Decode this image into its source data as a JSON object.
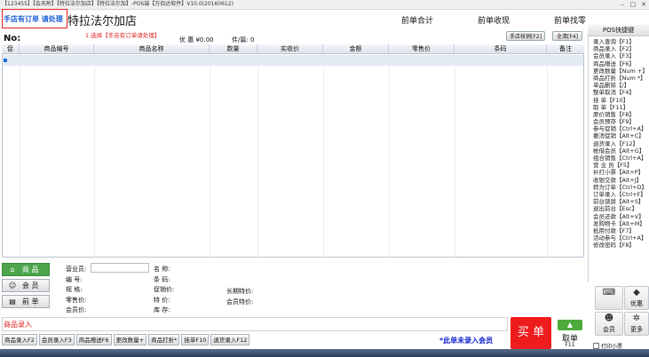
{
  "titlebar": {
    "text": "【123455】【会天附】【特拉法尔加店】【特拉法尔加】-POS端【万佰达软件】V10.0(20160612)"
  },
  "header": {
    "order_link": "手店有订单 请处理",
    "store_name": "特拉法尔加店",
    "note": "1.选择【手店有订单请处理】",
    "prev_total": "前单合计",
    "prev_received": "前单收现",
    "prev_change": "前单找零",
    "no_label": "No:",
    "discount": "优 惠 ¥0.00",
    "count": "件/篇: 0",
    "btn_handheld": "手店核销[F2]",
    "btn_fullscreen": "全清[F4]"
  },
  "table": {
    "columns": [
      "促",
      "商品编号",
      "商品名称",
      "数量",
      "实收价",
      "金额",
      "零售价",
      "条码",
      "备注"
    ]
  },
  "pos_panel": {
    "title": "POS快捷键",
    "items": [
      "录入查询【F1】",
      "商品录入【F2】",
      "会员录入【F3】",
      "商品赠送【F6】",
      "更改数量【Num +】",
      "商品打折【Num *】",
      "单品删除【/】",
      "整单取消【F4】",
      "挂 单【F10】",
      "取 单【F11】",
      "原价销售【F8】",
      "会员预存【F9】",
      "参与促销【Ctrl+A】",
      "撤消促销【Alt+C】",
      "退货录入【F12】",
      "帐借会员【Alt+G】",
      "组合销售【Ctrl+A】",
      "营 业 员【F5】",
      "补打小票【Alt+P】",
      "收银交款【Alt+J】",
      "转为订单【Ctrl+D】",
      "订单录入【Ctrl+F】",
      "前台锁屏【Alt+S】",
      "退出前台【Esc】",
      "会员还款【Alt+V】",
      "发购物卡【Alt+M】",
      "抵用付款【F7】",
      "活动参与【Ctrl+A】",
      "修改密码【F8】"
    ]
  },
  "left_tabs": [
    {
      "label": "商 品",
      "icon": "home-icon"
    },
    {
      "label": "会 员",
      "icon": "user-icon"
    },
    {
      "label": "前 单",
      "icon": "receipt-icon"
    }
  ],
  "info": {
    "operator": "营业员:",
    "code": "编 号:",
    "spec": "规 格:",
    "retail": "零售价:",
    "member_price": "会员价:",
    "name": "名 称:",
    "barcode": "条 码:",
    "promo_price": "促销价:",
    "special": "特 价:",
    "stock": "库 存:",
    "long_special": "长期特价:",
    "member_special": "会员特价:"
  },
  "entry": {
    "label": "商品录入"
  },
  "fkeys": [
    "商品录入F2",
    "会员录入F3",
    "商品赠送F6",
    "更改数量+",
    "商品打折*",
    "挂单F10",
    "退货录入F12"
  ],
  "member_warn": "*此单未录入会员",
  "checkout": {
    "label": "买 单"
  },
  "pickup": {
    "label": "取单",
    "key": "F11"
  },
  "tiles": [
    {
      "label": "",
      "icon": "keyboard-icon"
    },
    {
      "label": "优惠",
      "icon": "tag-icon"
    },
    {
      "label": "会员",
      "icon": "members-icon"
    },
    {
      "label": "更多",
      "icon": "more-icon"
    }
  ],
  "print_receipt": "打印小票"
}
